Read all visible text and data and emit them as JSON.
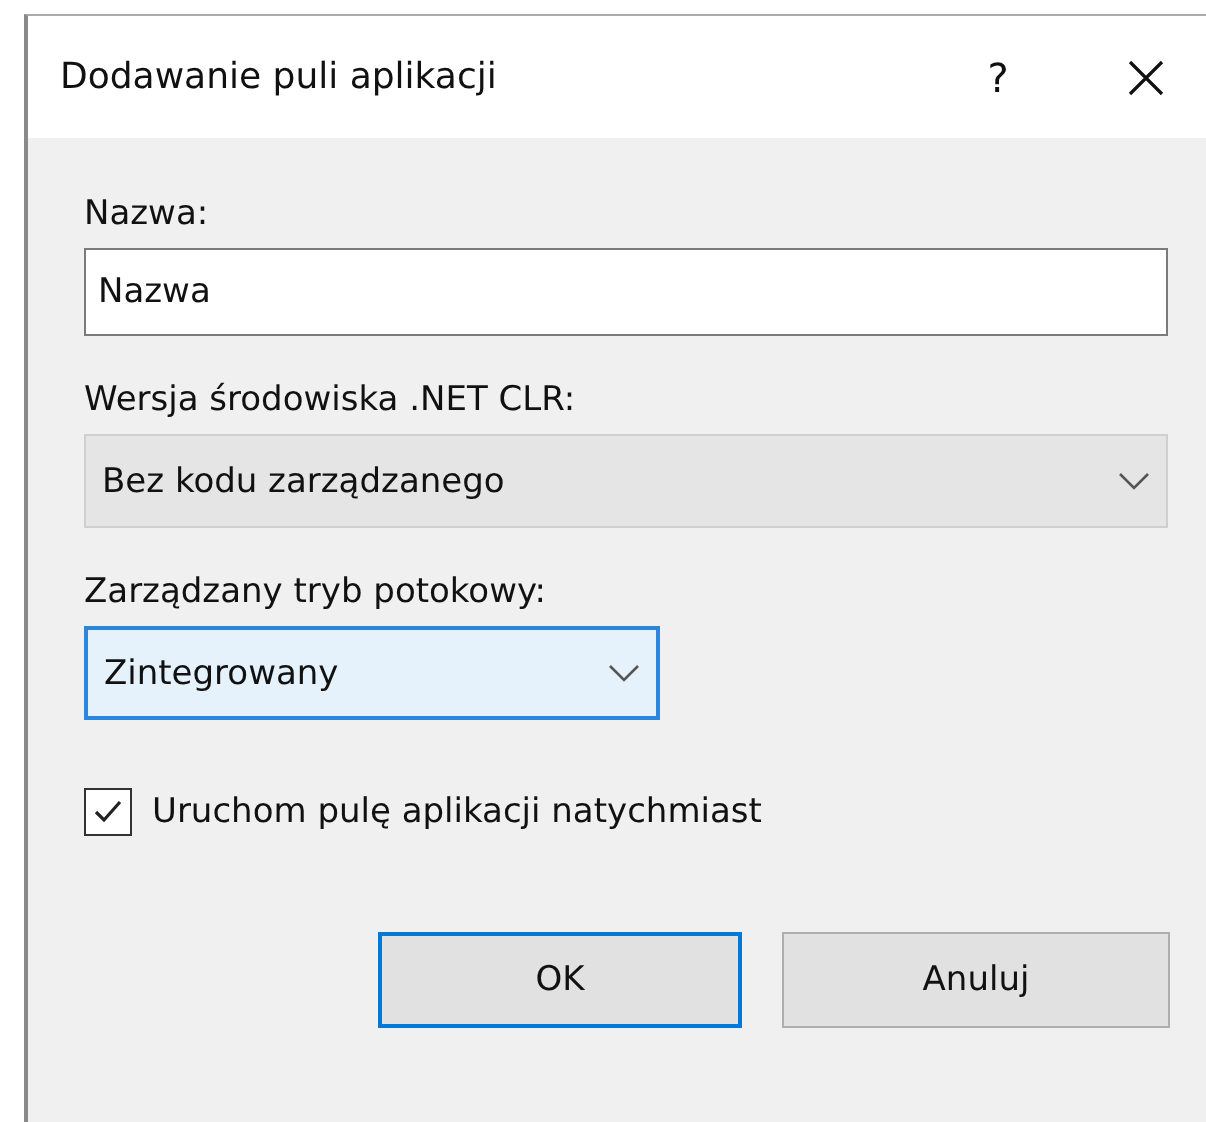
{
  "window": {
    "title": "Dodawanie puli aplikacji",
    "help": "?"
  },
  "name_field": {
    "label": "Nazwa:",
    "value": "Nazwa"
  },
  "dropdowns": [
    {
      "label": "Wersja środowiska .NET CLR:",
      "value": "Bez kodu zarządzanego",
      "focused": false,
      "wide": true
    },
    {
      "label": "Zarządzany tryb potokowy:",
      "value": "Zintegrowany",
      "focused": true,
      "wide": false
    }
  ],
  "start_checkbox": {
    "label": "Uruchom pulę aplikacji natychmiast",
    "checked": true
  },
  "buttons": [
    {
      "label": "OK",
      "default": true
    },
    {
      "label": "Anuluj",
      "default": false
    }
  ]
}
